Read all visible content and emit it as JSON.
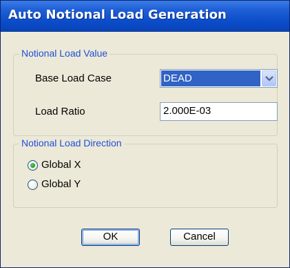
{
  "window": {
    "title": "Auto Notional Load Generation"
  },
  "value_group": {
    "legend": "Notional Load Value",
    "base_case_label": "Base Load Case",
    "base_case_value": "DEAD",
    "load_ratio_label": "Load Ratio",
    "load_ratio_value": "2.000E-03"
  },
  "direction_group": {
    "legend": "Notional Load Direction",
    "options": [
      {
        "label": "Global X",
        "selected": true
      },
      {
        "label": "Global Y",
        "selected": false
      }
    ]
  },
  "buttons": {
    "ok_label": "OK",
    "cancel_label": "Cancel"
  },
  "icons": {
    "combo_arrow": "chevron-down-icon",
    "radio_selected": "radio-selected-icon",
    "radio_unselected": "radio-unselected-icon"
  },
  "colors": {
    "titlebar": "#0a4cc9",
    "selection": "#3163c5",
    "group_legend": "#1f4fd9",
    "dialog_bg": "#ece9d8"
  }
}
